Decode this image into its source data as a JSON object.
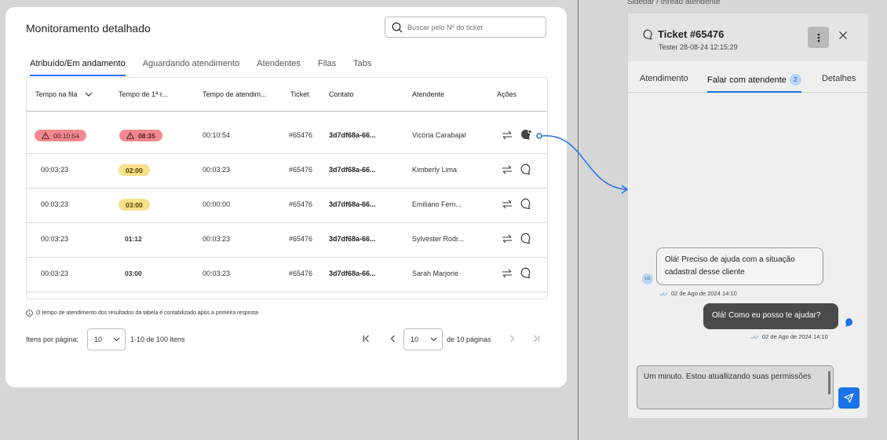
{
  "main": {
    "title": "Monitoramento detalhado",
    "search_placeholder": "Buscar pelo Nº do ticket",
    "tabs": [
      {
        "label": "Atribuído/Em andamento",
        "active": true
      },
      {
        "label": "Aguardando atendimento"
      },
      {
        "label": "Atendentes"
      },
      {
        "label": "Filas"
      },
      {
        "label": "Tabs"
      }
    ],
    "columns": [
      "Tempo na fila",
      "Tempo de 1ª r...",
      "Tempo de atendim...",
      "Ticket",
      "Contato",
      "Atendente",
      "Ações"
    ],
    "rows": [
      {
        "queue": "00:10:54",
        "first": "08:35",
        "service": "00:10:54",
        "ticket": "#65476",
        "contact": "3d7df68a-66...",
        "agent": "Vicória Carabajal"
      },
      {
        "queue": "00:03:23",
        "first": "02:00",
        "service": "00:03:23",
        "ticket": "#65476",
        "contact": "3d7df68a-66...",
        "agent": "Kimberly Lima"
      },
      {
        "queue": "00:03:23",
        "first": "03:00",
        "service": "00:00:00",
        "ticket": "#65476",
        "contact": "3d7df68a-66...",
        "agent": "Emiliano Fern..."
      },
      {
        "queue": "00:03:23",
        "first": "01:12",
        "service": "00:03:23",
        "ticket": "#65476",
        "contact": "3d7df68a-66...",
        "agent": "Sylvester Rodr..."
      },
      {
        "queue": "00:03:23",
        "first": "03:00",
        "service": "00:03:23",
        "ticket": "#65476",
        "contact": "3d7df68a-66...",
        "agent": "Sarah Marjorie"
      }
    ],
    "note": "O tempo de atendimento dos resultados da tabela é contabilizado após a primeira resposta",
    "pagination": {
      "per_page_label": "Itens por página:",
      "per_page_value": "10",
      "range_label": "1-10 de 100 itens",
      "page_value": "10",
      "pages_label": "de 10 páginas"
    }
  },
  "caption": "Sidebar / thread atendente",
  "sidebar": {
    "title": "Ticket #65476",
    "subtitle": "Tester 28-08-24 12:15:29",
    "tabs": [
      {
        "label": "Atendimento"
      },
      {
        "label": "Falar com atendente",
        "badge": "2",
        "active": true
      },
      {
        "label": "Detalhes"
      }
    ],
    "messages": [
      {
        "avatar": "LG",
        "text": "Olá! Preciso de ajuda com a situação cadastral desse cliente",
        "time": "02 de Ago de 2024 14:10"
      },
      {
        "text": "Olá! Como eu posso te ajudar?",
        "time": "02 de Ago de 2024 14:10"
      }
    ],
    "composer_value": "Um minuto. Estou atuallizando suas permissões"
  },
  "colors": {
    "accent": "#1a73e8",
    "alert": "#f08a8f",
    "warn": "#f7e08a"
  }
}
